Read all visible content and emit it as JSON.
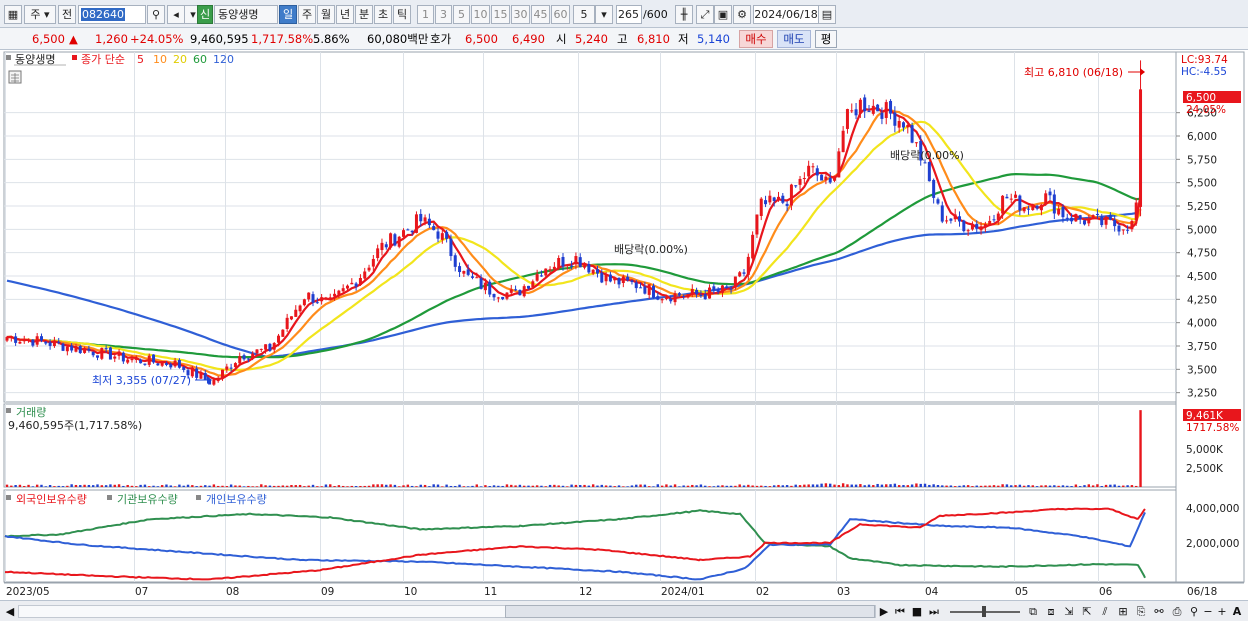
{
  "toolbar": {
    "market_select": "주",
    "prev_label": "전",
    "stock_code": "082640",
    "new_badge": "신",
    "stock_name": "동양생명",
    "periods": [
      "일",
      "주",
      "월",
      "년",
      "분",
      "초",
      "틱"
    ],
    "active_period": "일",
    "intervals": [
      "1",
      "3",
      "5",
      "10",
      "15",
      "30",
      "45",
      "60"
    ],
    "interval_value": "5",
    "count_value": "265",
    "count_total": "/600",
    "date_value": "2024/06/18"
  },
  "quote": {
    "price": "6,500",
    "change": "1,260",
    "change_pct": "+24.05%",
    "volume": "9,460,595",
    "volume_ratio": "1,717.58%",
    "turnover_pct": "5.86%",
    "amount": "60,080백만",
    "bid_ask_label": "호가",
    "ask": "6,500",
    "bid": "6,490",
    "open_label": "시",
    "open": "5,240",
    "high_label": "고",
    "high": "6,810",
    "low_label": "저",
    "low": "5,140",
    "buy_label": "매수",
    "sell_label": "매도",
    "eval_label": "평"
  },
  "legend": {
    "name": "동양생명",
    "close_label": "종가 단순",
    "ma": [
      "5",
      "10",
      "20",
      "60",
      "120"
    ],
    "lc": "LC:93.74",
    "hc": "HC:-4.55"
  },
  "annotations": {
    "high": "최고 6,810 (06/18)",
    "low": "최저 3,355 (07/27)",
    "dividend1": "배당락(0.00%)",
    "dividend2": "배당락(0.00%)",
    "price_box": "6,500",
    "price_pct": "24.05%"
  },
  "volume_panel": {
    "title": "거래량",
    "value": "9,460,595주(1,717.58%)",
    "box": "9,461K",
    "box_pct": "1717.58%",
    "ticks": [
      "5,000K",
      "2,500K"
    ]
  },
  "holdings_panel": {
    "labels": [
      "외국인보유수량",
      "기관보유수량",
      "개인보유수량"
    ],
    "ticks": [
      "4,000,000",
      "2,000,000"
    ]
  },
  "colors": {
    "ma5": "#e8161c",
    "ma10": "#ff8c1a",
    "ma20": "#f2e51c",
    "ma60": "#1f9a3a",
    "ma120": "#2f5fd6",
    "up": "#e8161c",
    "down": "#1f3fd0",
    "foreign": "#e8161c",
    "institution": "#2f8f4f",
    "individual": "#2f5fd6"
  },
  "chart_data": {
    "type": "candlestick",
    "y_ticks": [
      "6,250",
      "6,000",
      "5,750",
      "5,500",
      "5,250",
      "5,000",
      "4,750",
      "4,500",
      "4,250",
      "4,000",
      "3,750",
      "3,500",
      "3,250"
    ],
    "ylim": [
      3150,
      6900
    ],
    "x_ticks": [
      "2023/05",
      "07",
      "08",
      "09",
      "10",
      "11",
      "12",
      "2024/01",
      "02",
      "03",
      "04",
      "05",
      "06",
      "06/18"
    ],
    "close_approx": [
      {
        "x": "2023/05",
        "y": 3850
      },
      {
        "x": "07",
        "y": 3600
      },
      {
        "x": "07/27",
        "y": 3355
      },
      {
        "x": "08",
        "y": 3700
      },
      {
        "x": "09",
        "y": 4300
      },
      {
        "x": "10",
        "y": 5100
      },
      {
        "x": "11",
        "y": 4300
      },
      {
        "x": "12",
        "y": 4600
      },
      {
        "x": "2024/01",
        "y": 4300
      },
      {
        "x": "02",
        "y": 5300
      },
      {
        "x": "03",
        "y": 6350
      },
      {
        "x": "04",
        "y": 5100
      },
      {
        "x": "05",
        "y": 5300
      },
      {
        "x": "06",
        "y": 5000
      },
      {
        "x": "06/18",
        "y": 6500
      }
    ]
  }
}
